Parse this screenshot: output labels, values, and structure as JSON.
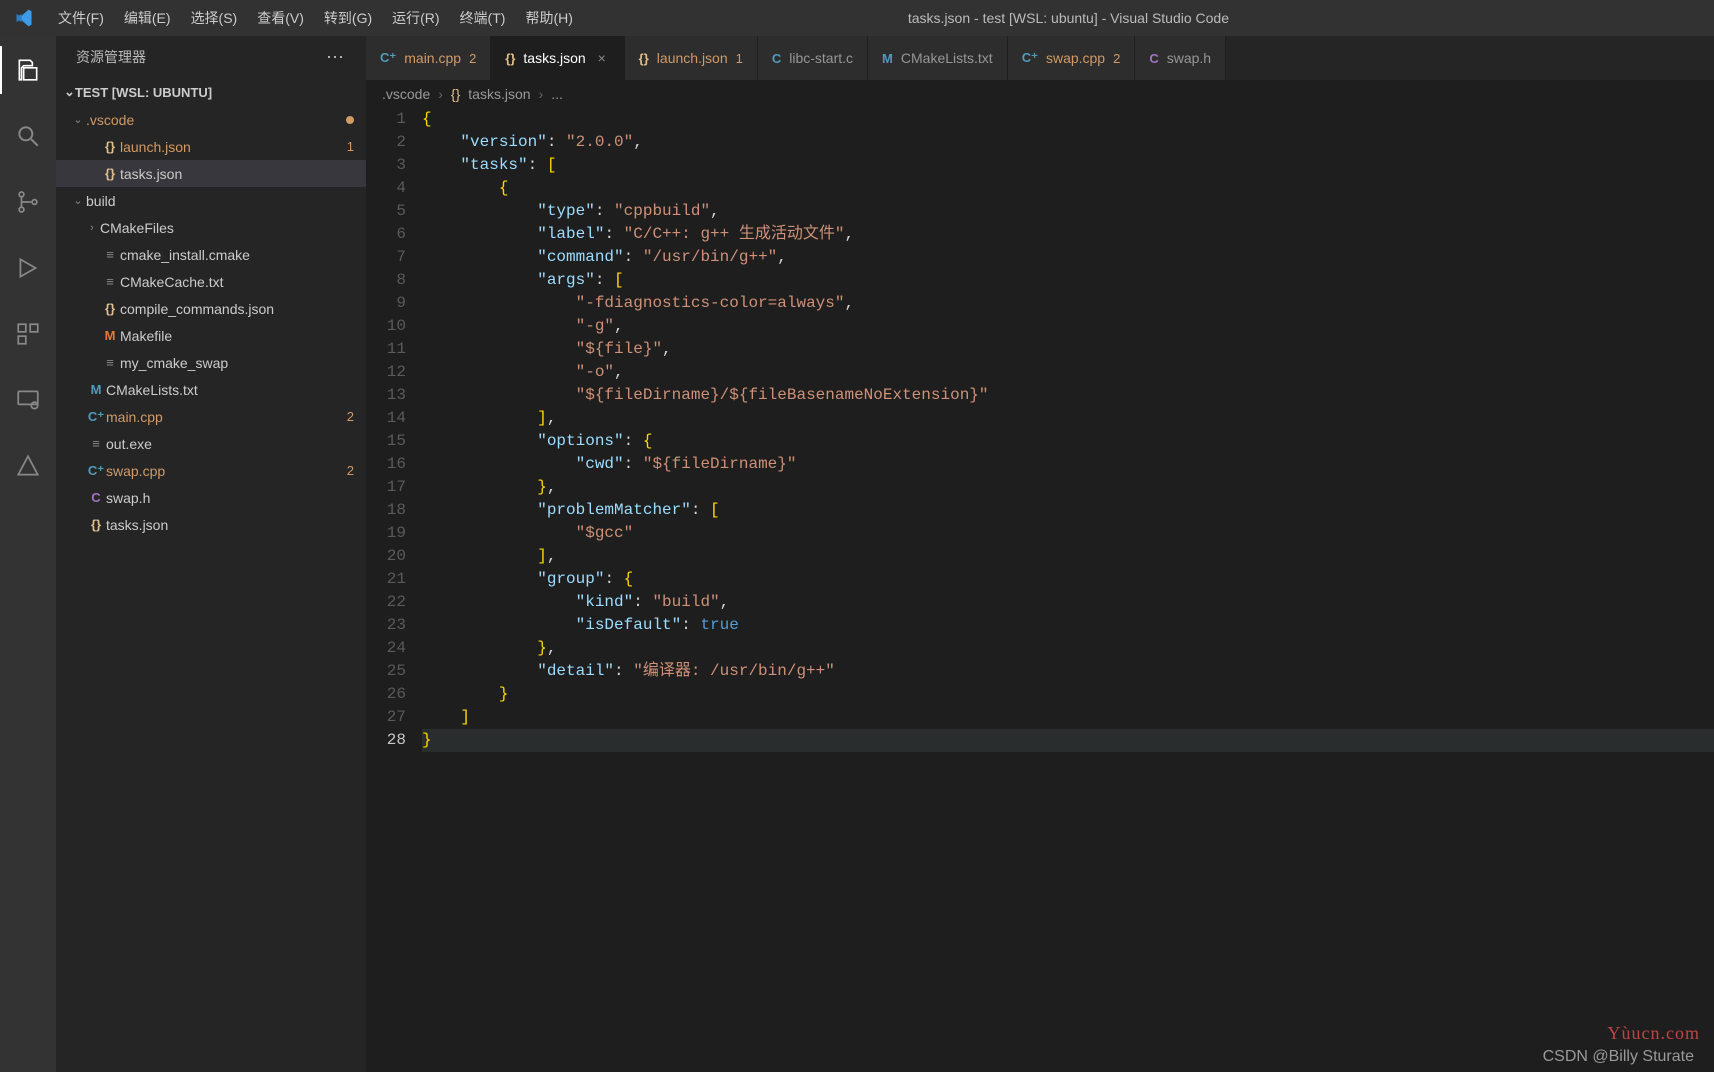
{
  "window": {
    "title": "tasks.json - test [WSL: ubuntu] - Visual Studio Code"
  },
  "menu": [
    "文件(F)",
    "编辑(E)",
    "选择(S)",
    "查看(V)",
    "转到(G)",
    "运行(R)",
    "终端(T)",
    "帮助(H)"
  ],
  "sidebar": {
    "title": "资源管理器",
    "project": "TEST [WSL: UBUNTU]",
    "tree": [
      {
        "name": ".vscode",
        "type": "folder",
        "depth": 0,
        "expanded": true,
        "modified": true,
        "dot": true
      },
      {
        "name": "launch.json",
        "type": "file",
        "icon": "{}",
        "iconColor": "#e2c08d",
        "depth": 1,
        "modified": true,
        "badge": "1"
      },
      {
        "name": "tasks.json",
        "type": "file",
        "icon": "{}",
        "iconColor": "#e2c08d",
        "depth": 1,
        "active": true
      },
      {
        "name": "build",
        "type": "folder",
        "depth": 0,
        "expanded": true
      },
      {
        "name": "CMakeFiles",
        "type": "folder",
        "depth": 1,
        "expanded": false
      },
      {
        "name": "cmake_install.cmake",
        "type": "file",
        "icon": "≡",
        "iconColor": "#888888",
        "depth": 1
      },
      {
        "name": "CMakeCache.txt",
        "type": "file",
        "icon": "≡",
        "iconColor": "#888888",
        "depth": 1
      },
      {
        "name": "compile_commands.json",
        "type": "file",
        "icon": "{}",
        "iconColor": "#e2c08d",
        "depth": 1
      },
      {
        "name": "Makefile",
        "type": "file",
        "icon": "M",
        "iconColor": "#e37933",
        "depth": 1
      },
      {
        "name": "my_cmake_swap",
        "type": "file",
        "icon": "≡",
        "iconColor": "#888888",
        "depth": 1
      },
      {
        "name": "CMakeLists.txt",
        "type": "file",
        "icon": "M",
        "iconColor": "#519aba",
        "depth": 0
      },
      {
        "name": "main.cpp",
        "type": "file",
        "icon": "C⁺",
        "iconColor": "#519aba",
        "depth": 0,
        "modified": true,
        "badge": "2"
      },
      {
        "name": "out.exe",
        "type": "file",
        "icon": "≡",
        "iconColor": "#888888",
        "depth": 0
      },
      {
        "name": "swap.cpp",
        "type": "file",
        "icon": "C⁺",
        "iconColor": "#519aba",
        "depth": 0,
        "modified": true,
        "badge": "2"
      },
      {
        "name": "swap.h",
        "type": "file",
        "icon": "C",
        "iconColor": "#a074c4",
        "depth": 0
      },
      {
        "name": "tasks.json",
        "type": "file",
        "icon": "{}",
        "iconColor": "#e2c08d",
        "depth": 0
      }
    ]
  },
  "tabs": [
    {
      "label": "main.cpp",
      "icon": "C⁺",
      "iconColor": "#519aba",
      "badge": "2"
    },
    {
      "label": "tasks.json",
      "icon": "{}",
      "iconColor": "#e2c08d",
      "active": true,
      "close": true
    },
    {
      "label": "launch.json",
      "icon": "{}",
      "iconColor": "#e2c08d",
      "badge": "1"
    },
    {
      "label": "libc-start.c",
      "icon": "C",
      "iconColor": "#519aba"
    },
    {
      "label": "CMakeLists.txt",
      "icon": "M",
      "iconColor": "#519aba"
    },
    {
      "label": "swap.cpp",
      "icon": "C⁺",
      "iconColor": "#519aba",
      "badge": "2"
    },
    {
      "label": "swap.h",
      "icon": "C",
      "iconColor": "#a074c4",
      "truncated": true
    }
  ],
  "breadcrumb": {
    "p0": ".vscode",
    "p1": "tasks.json",
    "p2": "...",
    "icon": "{}"
  },
  "code": {
    "lines": [
      {
        "n": 1,
        "tokens": [
          {
            "t": "brace",
            "v": "{"
          }
        ]
      },
      {
        "n": 2,
        "tokens": [
          {
            "t": "ind",
            "v": "    "
          },
          {
            "t": "key",
            "v": "\"version\""
          },
          {
            "t": "punct",
            "v": ": "
          },
          {
            "t": "str",
            "v": "\"2.0.0\""
          },
          {
            "t": "punct",
            "v": ","
          }
        ]
      },
      {
        "n": 3,
        "tokens": [
          {
            "t": "ind",
            "v": "    "
          },
          {
            "t": "key",
            "v": "\"tasks\""
          },
          {
            "t": "punct",
            "v": ": "
          },
          {
            "t": "brace",
            "v": "["
          }
        ]
      },
      {
        "n": 4,
        "tokens": [
          {
            "t": "ind",
            "v": "        "
          },
          {
            "t": "brace",
            "v": "{"
          }
        ]
      },
      {
        "n": 5,
        "tokens": [
          {
            "t": "ind",
            "v": "            "
          },
          {
            "t": "key",
            "v": "\"type\""
          },
          {
            "t": "punct",
            "v": ": "
          },
          {
            "t": "str",
            "v": "\"cppbuild\""
          },
          {
            "t": "punct",
            "v": ","
          }
        ]
      },
      {
        "n": 6,
        "tokens": [
          {
            "t": "ind",
            "v": "            "
          },
          {
            "t": "key",
            "v": "\"label\""
          },
          {
            "t": "punct",
            "v": ": "
          },
          {
            "t": "str",
            "v": "\"C/C++: g++ 生成活动文件\""
          },
          {
            "t": "punct",
            "v": ","
          }
        ]
      },
      {
        "n": 7,
        "tokens": [
          {
            "t": "ind",
            "v": "            "
          },
          {
            "t": "key",
            "v": "\"command\""
          },
          {
            "t": "punct",
            "v": ": "
          },
          {
            "t": "str",
            "v": "\"/usr/bin/g++\""
          },
          {
            "t": "punct",
            "v": ","
          }
        ]
      },
      {
        "n": 8,
        "tokens": [
          {
            "t": "ind",
            "v": "            "
          },
          {
            "t": "key",
            "v": "\"args\""
          },
          {
            "t": "punct",
            "v": ": "
          },
          {
            "t": "brace",
            "v": "["
          }
        ]
      },
      {
        "n": 9,
        "tokens": [
          {
            "t": "ind",
            "v": "                "
          },
          {
            "t": "str",
            "v": "\"-fdiagnostics-color=always\""
          },
          {
            "t": "punct",
            "v": ","
          }
        ]
      },
      {
        "n": 10,
        "tokens": [
          {
            "t": "ind",
            "v": "                "
          },
          {
            "t": "str",
            "v": "\"-g\""
          },
          {
            "t": "punct",
            "v": ","
          }
        ]
      },
      {
        "n": 11,
        "tokens": [
          {
            "t": "ind",
            "v": "                "
          },
          {
            "t": "str",
            "v": "\"${file}\""
          },
          {
            "t": "punct",
            "v": ","
          }
        ]
      },
      {
        "n": 12,
        "tokens": [
          {
            "t": "ind",
            "v": "                "
          },
          {
            "t": "str",
            "v": "\"-o\""
          },
          {
            "t": "punct",
            "v": ","
          }
        ]
      },
      {
        "n": 13,
        "tokens": [
          {
            "t": "ind",
            "v": "                "
          },
          {
            "t": "str",
            "v": "\"${fileDirname}/${fileBasenameNoExtension}\""
          }
        ]
      },
      {
        "n": 14,
        "tokens": [
          {
            "t": "ind",
            "v": "            "
          },
          {
            "t": "brace",
            "v": "]"
          },
          {
            "t": "punct",
            "v": ","
          }
        ]
      },
      {
        "n": 15,
        "tokens": [
          {
            "t": "ind",
            "v": "            "
          },
          {
            "t": "key",
            "v": "\"options\""
          },
          {
            "t": "punct",
            "v": ": "
          },
          {
            "t": "brace",
            "v": "{"
          }
        ]
      },
      {
        "n": 16,
        "tokens": [
          {
            "t": "ind",
            "v": "                "
          },
          {
            "t": "key",
            "v": "\"cwd\""
          },
          {
            "t": "punct",
            "v": ": "
          },
          {
            "t": "str",
            "v": "\"${fileDirname}\""
          }
        ]
      },
      {
        "n": 17,
        "tokens": [
          {
            "t": "ind",
            "v": "            "
          },
          {
            "t": "brace",
            "v": "}"
          },
          {
            "t": "punct",
            "v": ","
          }
        ]
      },
      {
        "n": 18,
        "tokens": [
          {
            "t": "ind",
            "v": "            "
          },
          {
            "t": "key",
            "v": "\"problemMatcher\""
          },
          {
            "t": "punct",
            "v": ": "
          },
          {
            "t": "brace",
            "v": "["
          }
        ]
      },
      {
        "n": 19,
        "tokens": [
          {
            "t": "ind",
            "v": "                "
          },
          {
            "t": "str",
            "v": "\"$gcc\""
          }
        ]
      },
      {
        "n": 20,
        "tokens": [
          {
            "t": "ind",
            "v": "            "
          },
          {
            "t": "brace",
            "v": "]"
          },
          {
            "t": "punct",
            "v": ","
          }
        ]
      },
      {
        "n": 21,
        "tokens": [
          {
            "t": "ind",
            "v": "            "
          },
          {
            "t": "key",
            "v": "\"group\""
          },
          {
            "t": "punct",
            "v": ": "
          },
          {
            "t": "brace",
            "v": "{"
          }
        ]
      },
      {
        "n": 22,
        "tokens": [
          {
            "t": "ind",
            "v": "                "
          },
          {
            "t": "key",
            "v": "\"kind\""
          },
          {
            "t": "punct",
            "v": ": "
          },
          {
            "t": "str",
            "v": "\"build\""
          },
          {
            "t": "punct",
            "v": ","
          }
        ]
      },
      {
        "n": 23,
        "tokens": [
          {
            "t": "ind",
            "v": "                "
          },
          {
            "t": "key",
            "v": "\"isDefault\""
          },
          {
            "t": "punct",
            "v": ": "
          },
          {
            "t": "kw",
            "v": "true"
          }
        ]
      },
      {
        "n": 24,
        "tokens": [
          {
            "t": "ind",
            "v": "            "
          },
          {
            "t": "brace",
            "v": "}"
          },
          {
            "t": "punct",
            "v": ","
          }
        ]
      },
      {
        "n": 25,
        "tokens": [
          {
            "t": "ind",
            "v": "            "
          },
          {
            "t": "key",
            "v": "\"detail\""
          },
          {
            "t": "punct",
            "v": ": "
          },
          {
            "t": "str",
            "v": "\"编译器: /usr/bin/g++\""
          }
        ]
      },
      {
        "n": 26,
        "tokens": [
          {
            "t": "ind",
            "v": "        "
          },
          {
            "t": "brace",
            "v": "}"
          }
        ]
      },
      {
        "n": 27,
        "tokens": [
          {
            "t": "ind",
            "v": "    "
          },
          {
            "t": "brace",
            "v": "]"
          }
        ]
      },
      {
        "n": 28,
        "tokens": [
          {
            "t": "brace",
            "v": "}"
          }
        ],
        "hl": true
      }
    ]
  },
  "watermark": {
    "br": "Yùucn.com",
    "bl": "CSDN @Billy Sturate"
  }
}
